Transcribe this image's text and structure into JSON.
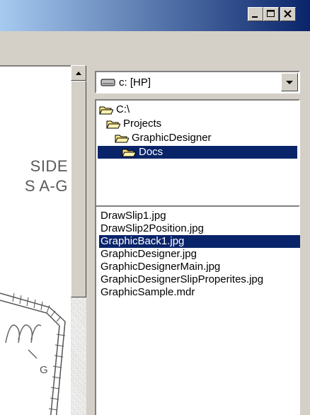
{
  "window": {
    "controls": {
      "minimize_icon": "minimize-icon",
      "maximize_icon": "maximize-icon",
      "close_icon": "close-icon"
    }
  },
  "preview": {
    "text_line1": "SIDE",
    "text_line2": "S A-G",
    "label_g": "G"
  },
  "drive": {
    "selected": "c: [HP]",
    "icon": "drive-icon"
  },
  "directories": [
    {
      "label": "C:\\",
      "selected": false
    },
    {
      "label": "Projects",
      "selected": false
    },
    {
      "label": "GraphicDesigner",
      "selected": false
    },
    {
      "label": "Docs",
      "selected": true
    }
  ],
  "files": [
    {
      "name": "DrawSlip1.jpg",
      "selected": false
    },
    {
      "name": "DrawSlip2Position.jpg",
      "selected": false
    },
    {
      "name": "GraphicBack1.jpg",
      "selected": true
    },
    {
      "name": "GraphicDesigner.jpg",
      "selected": false
    },
    {
      "name": "GraphicDesignerMain.jpg",
      "selected": false
    },
    {
      "name": "GraphicDesignerSlipProperites.jpg",
      "selected": false
    },
    {
      "name": "GraphicSample.mdr",
      "selected": false
    }
  ],
  "colors": {
    "selection": "#0a246a",
    "title_gradient_start": "#a6caf0",
    "title_gradient_end": "#0a246a"
  }
}
